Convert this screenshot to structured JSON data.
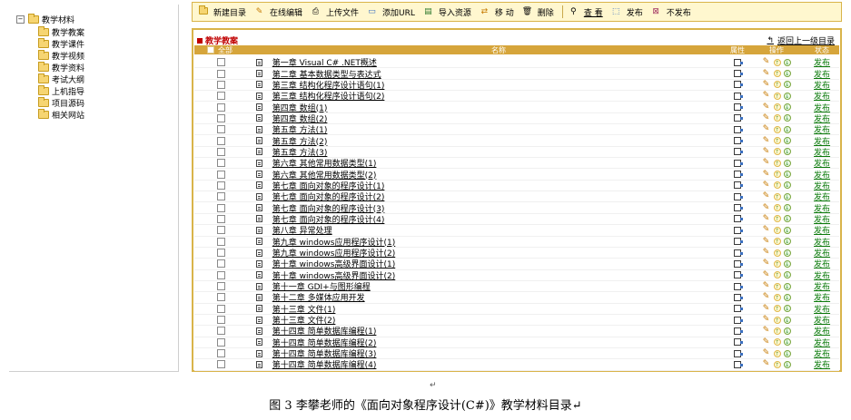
{
  "tree": {
    "root": {
      "label": "教学材料",
      "toggle": "−"
    },
    "children": [
      {
        "label": "教学教案"
      },
      {
        "label": "教学课件"
      },
      {
        "label": "教学视频"
      },
      {
        "label": "教学资料"
      },
      {
        "label": "考试大纲"
      },
      {
        "label": "上机指导"
      },
      {
        "label": "项目源码"
      },
      {
        "label": "相关网站"
      }
    ]
  },
  "toolbar": {
    "items": [
      {
        "label": "新建目录",
        "icon": "folder-icon"
      },
      {
        "label": "在线编辑",
        "icon": "pencil-icon"
      },
      {
        "label": "上传文件",
        "icon": "upload-icon"
      },
      {
        "label": "添加URL",
        "icon": "url-icon"
      },
      {
        "label": "导入资源",
        "icon": "import-icon"
      },
      {
        "label": "移 动",
        "icon": "move-icon"
      },
      {
        "label": "删除",
        "icon": "delete-icon"
      },
      {
        "label": "查 看",
        "icon": "search-icon"
      },
      {
        "label": "发布",
        "icon": "publish-icon"
      },
      {
        "label": "不发布",
        "icon": "unpublish-icon"
      }
    ]
  },
  "panel": {
    "title": "教学教案",
    "back_label": "返回上一级目录",
    "header": {
      "all": "全部",
      "name": "名称",
      "attr": "属性",
      "ops": "操作",
      "status": "状态"
    }
  },
  "rows": [
    {
      "name": "第一章 Visual C# .NET概述",
      "status": "发布"
    },
    {
      "name": "第二章 基本数据类型与表达式",
      "status": "发布"
    },
    {
      "name": "第三章 结构化程序设计语句(1)",
      "status": "发布"
    },
    {
      "name": "第三章 结构化程序设计语句(2)",
      "status": "发布"
    },
    {
      "name": "第四章 数组(1)",
      "status": "发布"
    },
    {
      "name": "第四章 数组(2)",
      "status": "发布"
    },
    {
      "name": "第五章 方法(1)",
      "status": "发布"
    },
    {
      "name": "第五章 方法(2)",
      "status": "发布"
    },
    {
      "name": "第五章 方法(3)",
      "status": "发布"
    },
    {
      "name": "第六章 其他常用数据类型(1)",
      "status": "发布"
    },
    {
      "name": "第六章 其他常用数据类型(2)",
      "status": "发布"
    },
    {
      "name": "第七章 面向对象的程序设计(1)",
      "status": "发布"
    },
    {
      "name": "第七章 面向对象的程序设计(2)",
      "status": "发布"
    },
    {
      "name": "第七章 面向对象的程序设计(3)",
      "status": "发布"
    },
    {
      "name": "第七章 面向对象的程序设计(4)",
      "status": "发布"
    },
    {
      "name": "第八章 异常处理",
      "status": "发布"
    },
    {
      "name": "第九章 windows应用程序设计(1)",
      "status": "发布"
    },
    {
      "name": "第九章 windows应用程序设计(2)",
      "status": "发布"
    },
    {
      "name": "第十章 windows高级界面设计(1)",
      "status": "发布"
    },
    {
      "name": "第十章 windows高级界面设计(2)",
      "status": "发布"
    },
    {
      "name": "第十一章 GDI+与图形编程",
      "status": "发布"
    },
    {
      "name": "第十二章 多媒体应用开发",
      "status": "发布"
    },
    {
      "name": "第十三章 文件(1)",
      "status": "发布"
    },
    {
      "name": "第十三章 文件(2)",
      "status": "发布"
    },
    {
      "name": "第十四章 简单数据库编程(1)",
      "status": "发布"
    },
    {
      "name": "第十四章 简单数据库编程(2)",
      "status": "发布"
    },
    {
      "name": "第十四章 简单数据库编程(3)",
      "status": "发布"
    },
    {
      "name": "第十四章 简单数据库编程(4)",
      "status": "发布"
    }
  ],
  "caption": {
    "mark": "↵",
    "text": "图 3 李攀老师的《面向对象程序设计(C#)》教学材料目录↵"
  },
  "colors": {
    "accent": "#d6a53b",
    "title_red": "#c00000",
    "status_green": "#0a7a0a"
  }
}
